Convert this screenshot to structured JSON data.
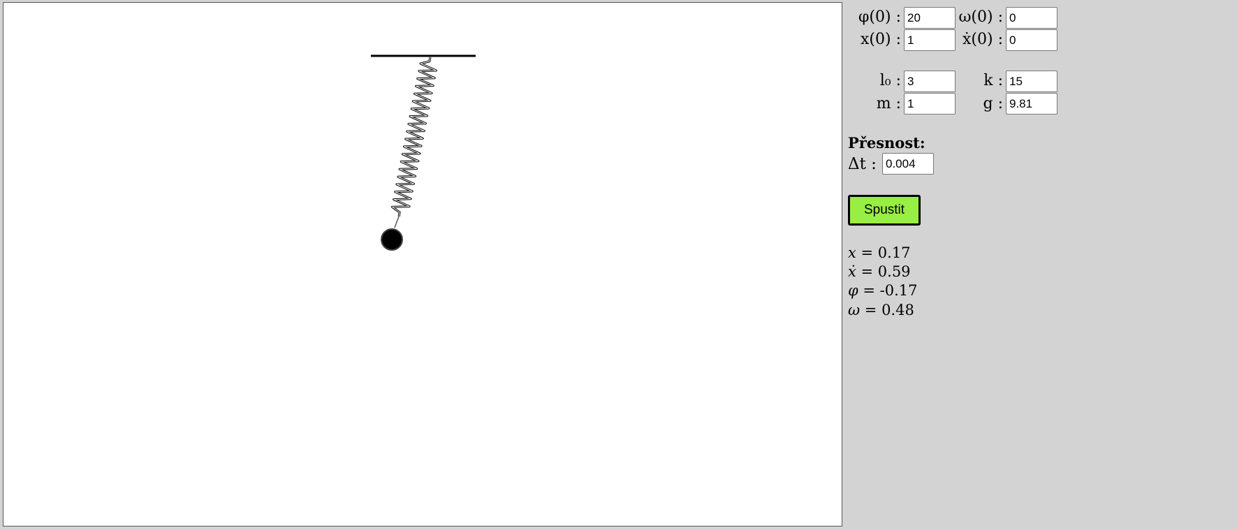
{
  "controls": {
    "phi0": {
      "label": "φ(0) :",
      "value": "20"
    },
    "omega0": {
      "label": "ω(0) :",
      "value": "0"
    },
    "x0": {
      "label": "x(0) :",
      "value": "1"
    },
    "xdot0": {
      "label": "ẋ(0) :",
      "value": "0"
    },
    "l0": {
      "label": "l₀ :",
      "value": "3"
    },
    "k": {
      "label": "k :",
      "value": "15"
    },
    "m": {
      "label": "m :",
      "value": "1"
    },
    "g": {
      "label": "g :",
      "value": "9.81"
    }
  },
  "precision": {
    "heading": "Přesnost:",
    "dt_label": "Δt :",
    "dt_value": "0.004"
  },
  "run_button": {
    "label": "Spustit",
    "color": "#99ee44"
  },
  "readouts": {
    "x": {
      "symbol": "x",
      "text": " = 0.17"
    },
    "xdot": {
      "symbol": "ẋ",
      "text": " = 0.59"
    },
    "phi": {
      "symbol": "φ",
      "text": " = -0.17"
    },
    "omega": {
      "symbol": "ω",
      "text": " = 0.48"
    }
  },
  "colors": {
    "panel_bg": "#d3d3d3",
    "canvas_bg": "#ffffff",
    "spring": "#000000",
    "bob": "#000000"
  }
}
